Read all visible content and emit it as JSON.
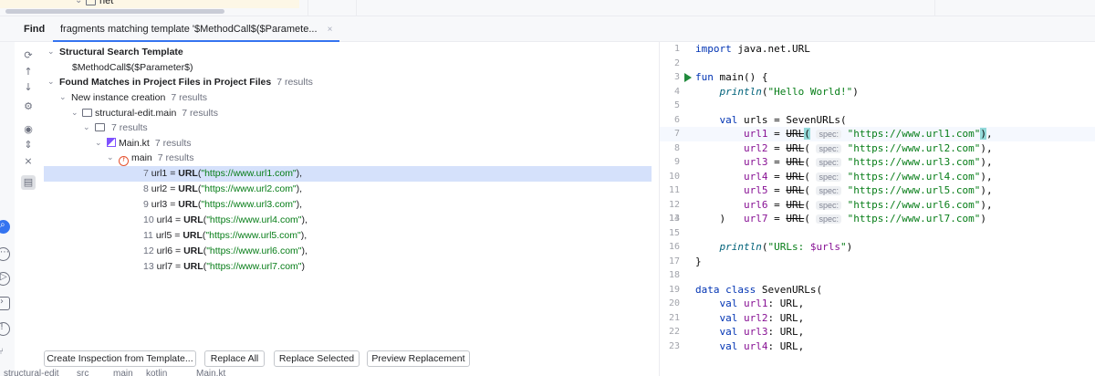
{
  "project_tree_tail": {
    "folder_label": "net"
  },
  "find_window": {
    "title": "Find",
    "tab_label": "fragments matching template '$MethodCall$($Paramete...",
    "tab_close": "×"
  },
  "tree": {
    "template_header": "Structural Search Template",
    "template_text": "$MethodCall$($Parameter$)",
    "found_header": "Found Matches in Project Files in Project Files",
    "found_count": "7 results",
    "new_instance": "New instance creation",
    "new_instance_count": "7 results",
    "module": "structural-edit.main",
    "module_count": "7 results",
    "package_count": "7 results",
    "file": "Main.kt",
    "file_count": "7 results",
    "function": "main",
    "function_count": "7 results",
    "matches": [
      {
        "line": "7",
        "var": "url1",
        "fn": "URL",
        "arg": "\"https://www.url1.com\""
      },
      {
        "line": "8",
        "var": "url2",
        "fn": "URL",
        "arg": "\"https://www.url2.com\""
      },
      {
        "line": "9",
        "var": "url3",
        "fn": "URL",
        "arg": "\"https://www.url3.com\""
      },
      {
        "line": "10",
        "var": "url4",
        "fn": "URL",
        "arg": "\"https://www.url4.com\""
      },
      {
        "line": "11",
        "var": "url5",
        "fn": "URL",
        "arg": "\"https://www.url5.com\""
      },
      {
        "line": "12",
        "var": "url6",
        "fn": "URL",
        "arg": "\"https://www.url6.com\""
      },
      {
        "line": "13",
        "var": "url7",
        "fn": "URL",
        "arg": "\"https://www.url7.com\""
      }
    ]
  },
  "buttons": {
    "create_inspection": "Create Inspection from Template...",
    "replace_all": "Replace All",
    "replace_selected": "Replace Selected",
    "preview": "Preview Replacement"
  },
  "editor": {
    "lines": [
      {
        "n": "1",
        "code": "import java.net.URL"
      },
      {
        "n": "2",
        "code": ""
      },
      {
        "n": "3",
        "code": "fun main() {"
      },
      {
        "n": "4",
        "code": "    println(\"Hello World!\")"
      },
      {
        "n": "5",
        "code": ""
      },
      {
        "n": "6",
        "code": "    val urls = SevenURLs("
      },
      {
        "n": "7",
        "code": "        url1 = URL( spec: \"https://www.url1.com\"),"
      },
      {
        "n": "8",
        "code": "        url2 = URL( spec: \"https://www.url2.com\"),"
      },
      {
        "n": "9",
        "code": "        url3 = URL( spec: \"https://www.url3.com\"),"
      },
      {
        "n": "10",
        "code": "        url4 = URL( spec: \"https://www.url4.com\"),"
      },
      {
        "n": "11",
        "code": "        url5 = URL( spec: \"https://www.url5.com\"),"
      },
      {
        "n": "12",
        "code": "        url6 = URL( spec: \"https://www.url6.com\"),"
      },
      {
        "n": "13",
        "code": "        url7 = URL( spec: \"https://www.url7.com\")"
      },
      {
        "n": "14",
        "code": "    )"
      },
      {
        "n": "15",
        "code": ""
      },
      {
        "n": "16",
        "code": "    println(\"URLs: $urls\")"
      },
      {
        "n": "17",
        "code": "}"
      },
      {
        "n": "18",
        "code": ""
      },
      {
        "n": "19",
        "code": "data class SevenURLs("
      },
      {
        "n": "20",
        "code": "    val url1: URL,"
      },
      {
        "n": "21",
        "code": "    val url2: URL,"
      },
      {
        "n": "22",
        "code": "    val url3: URL,"
      },
      {
        "n": "23",
        "code": "    val url4: URL,"
      }
    ]
  },
  "breadcrumb": [
    "structural-edit",
    "src",
    "main",
    "kotlin",
    "Main.kt"
  ],
  "colors": {
    "selection": "#d5e1fb",
    "accent": "#3574f0",
    "string": "#067d17",
    "keyword": "#0033b3"
  },
  "icons": {
    "find_toolbar": [
      "rerun-icon",
      "arrow-up-icon",
      "arrow-down-icon",
      "settings-icon",
      "eye-icon",
      "expand-icon",
      "collapse-icon",
      "preview-icon"
    ],
    "left_stripe": [
      "find-icon",
      "services-icon",
      "run-icon",
      "terminal-icon",
      "problems-icon",
      "git-icon"
    ]
  }
}
